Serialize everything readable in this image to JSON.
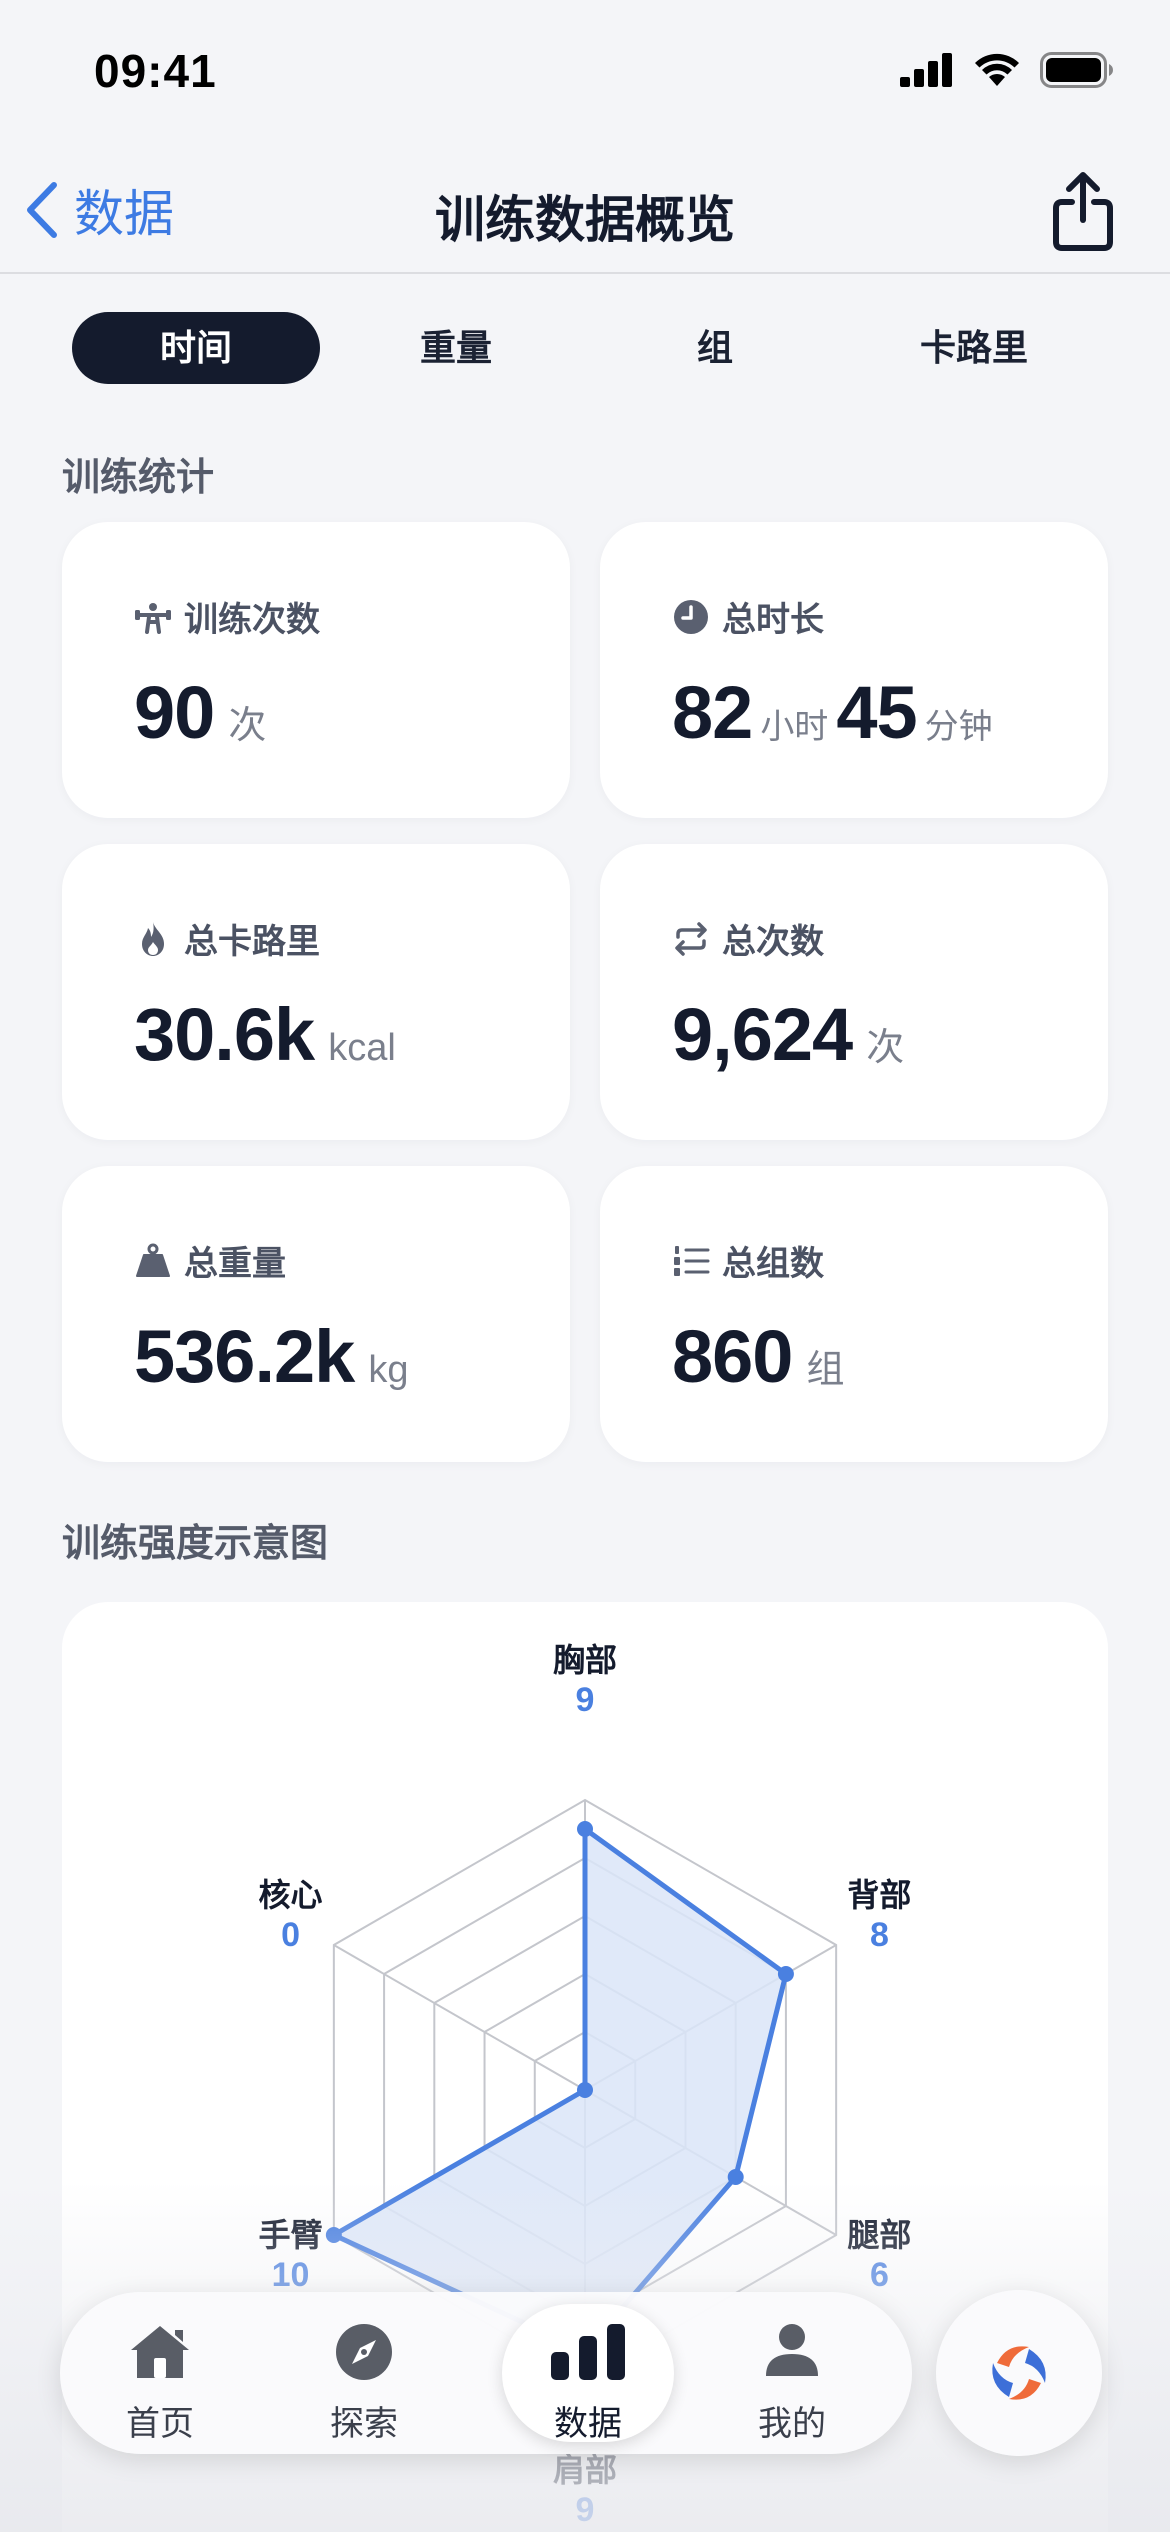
{
  "status_bar": {
    "time": "09:41"
  },
  "nav": {
    "back_label": "数据",
    "title": "训练数据概览"
  },
  "segments": [
    "时间",
    "重量",
    "组",
    "卡路里"
  ],
  "segment_selected": "时间",
  "stats_section_title": "训练统计",
  "stats": {
    "sessions": {
      "label": "训练次数",
      "value": "90",
      "unit": "次",
      "icon": "dumbbell-lift-icon"
    },
    "duration": {
      "label": "总时长",
      "hours": "82",
      "hours_unit": "小时",
      "minutes": "45",
      "minutes_unit": "分钟",
      "icon": "clock-icon"
    },
    "calories": {
      "label": "总卡路里",
      "value": "30.6k",
      "unit": "kcal",
      "icon": "flame-icon"
    },
    "reps": {
      "label": "总次数",
      "value": "9,624",
      "unit": "次",
      "icon": "repeat-icon"
    },
    "weight": {
      "label": "总重量",
      "value": "536.2k",
      "unit": "kg",
      "icon": "weight-icon"
    },
    "sets": {
      "label": "总组数",
      "value": "860",
      "unit": "组",
      "icon": "numbered-list-icon"
    }
  },
  "radar_section_title": "训练强度示意图",
  "colors": {
    "accent": "#4a80e0",
    "primary_dark": "#141b2d",
    "fill": "#dbe5f8"
  },
  "chart_data": {
    "type": "radar",
    "max": 10,
    "rings": 5,
    "axes": [
      {
        "label": "胸部",
        "value": 9
      },
      {
        "label": "背部",
        "value": 8
      },
      {
        "label": "腿部",
        "value": 6
      },
      {
        "label": "肩部",
        "value": 9
      },
      {
        "label": "手臂",
        "value": 10
      },
      {
        "label": "核心",
        "value": 0
      }
    ]
  },
  "tabs": [
    {
      "label": "首页",
      "icon": "house-icon"
    },
    {
      "label": "探索",
      "icon": "compass-icon"
    },
    {
      "label": "数据",
      "icon": "bar-chart-icon",
      "active": true
    },
    {
      "label": "我的",
      "icon": "person-icon"
    }
  ],
  "fab_icon": "app-logo-icon"
}
